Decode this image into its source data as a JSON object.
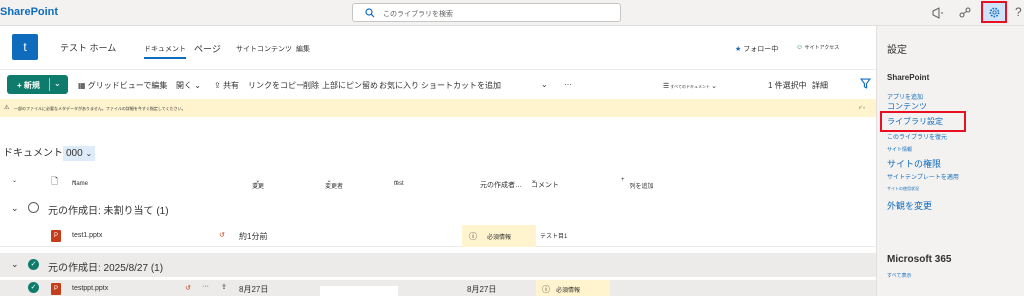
{
  "topbar": {
    "brand": "SharePoint",
    "search_placeholder": "このライブラリを検索",
    "help": "?"
  },
  "site": {
    "logo_letter": "t",
    "name": "テスト ホーム",
    "nav": [
      "ドキュメント",
      "ページ",
      "サイトコンテンツ",
      "編集"
    ],
    "follow": "フォロー中",
    "access": "サイトアクセス"
  },
  "commandbar": {
    "new_label": "+ 新規",
    "grid_edit": "グリッドビューで編集",
    "open": "開く",
    "share": "共有",
    "copy_link": "リンクをコピー",
    "delete": "削除",
    "pin_top": "上部にピン留め",
    "favorite": "お気に入り",
    "add_shortcut": "ショートカットを追加",
    "more": "···",
    "all_docs": "すべてのドキュメント",
    "selected": "1 件選択中",
    "details": "詳細"
  },
  "banner": {
    "text": "一部のファイルに必要なメタデータがありません。ファイルの詳細を今すぐ指定してください。",
    "close": "ﾃﾞｨ"
  },
  "view": {
    "title_prefix": "ドキュメント",
    "title_sel": "000"
  },
  "columns": {
    "name": "Name",
    "modified": "変更",
    "modified_by": "変更者",
    "test": "test",
    "creator": "元の作成者…",
    "comment": "コメント",
    "add_column": "列を追加"
  },
  "groups": [
    {
      "label": "元の作成日: 未割り当て (1)",
      "rows": [
        {
          "name": "test1.pptx",
          "modified": "約1分前",
          "status": "必須情報",
          "comment": "テスト目1"
        }
      ]
    },
    {
      "label": "元の作成日: 2025/8/27 (1)",
      "rows": [
        {
          "name": "testppt.pptx",
          "modified": "8月27日",
          "creator_date": "8月27日",
          "status": "必須情報"
        }
      ]
    }
  ],
  "settings_panel": {
    "title": "設定",
    "section": "SharePoint",
    "links": [
      "アプリを追加",
      "コンテンツ",
      "ライブラリ設定",
      "このライブラリを復元",
      "サイト情報",
      "サイトの権限",
      "サイトテンプレートを適用",
      "サイトの使用状況",
      "外観を変更"
    ],
    "m365": "Microsoft 365",
    "view_all": "すべて表示"
  },
  "colors": {
    "accent": "#0f6cbd",
    "new_button": "#0f7b6c",
    "warning_bg": "#fff4ce",
    "highlight_red": "#e81123"
  }
}
